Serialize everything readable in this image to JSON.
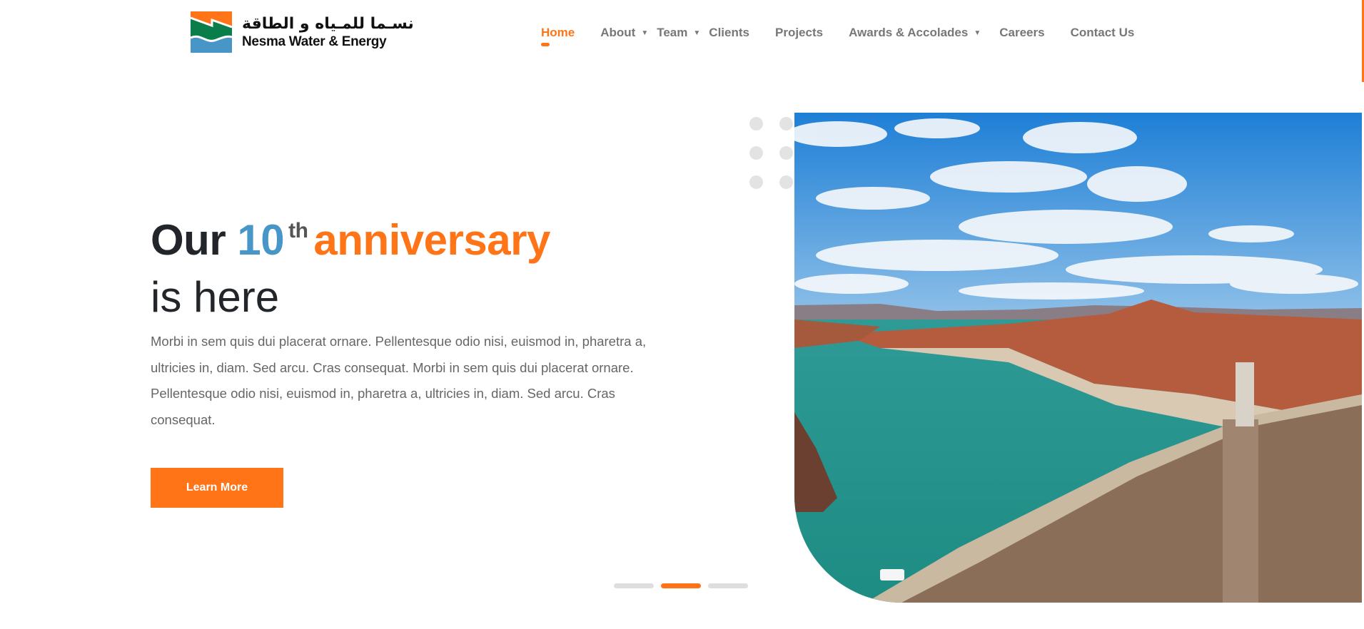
{
  "brand": {
    "name_ar": "نسـما للمـياه و الطاقة",
    "name_en": "Nesma Water & Energy",
    "colors": {
      "orange": "#ff7417",
      "green": "#0a7e4a",
      "blue": "#4896c8"
    }
  },
  "nav": {
    "items": [
      {
        "label": "Home",
        "active": true,
        "dropdown": false
      },
      {
        "label": "About",
        "dropdown": true
      },
      {
        "label": "Team",
        "dropdown": true
      },
      {
        "label": "Clients",
        "dropdown": false
      },
      {
        "label": "Projects",
        "dropdown": false
      },
      {
        "label": "Awards & Accolades",
        "dropdown": true
      },
      {
        "label": "Careers",
        "dropdown": false
      },
      {
        "label": "Contact Us",
        "dropdown": false
      }
    ]
  },
  "hero": {
    "title_our": "Our",
    "title_number": "10",
    "title_suffix": "th",
    "title_highlight": "anniversary",
    "title_line2": "is here",
    "description": "Morbi in sem quis dui placerat ornare. Pellentesque odio nisi, euismod in, pharetra a, ultricies in, diam. Sed arcu. Cras consequat. Morbi in sem quis dui placerat ornare. Pellentesque odio nisi, euismod in, pharetra a, ultricies in, diam. Sed arcu. Cras consequat.",
    "cta_label": "Learn More",
    "image": "dam-and-lake-photo",
    "slides": {
      "count": 3,
      "active_index": 2
    }
  }
}
